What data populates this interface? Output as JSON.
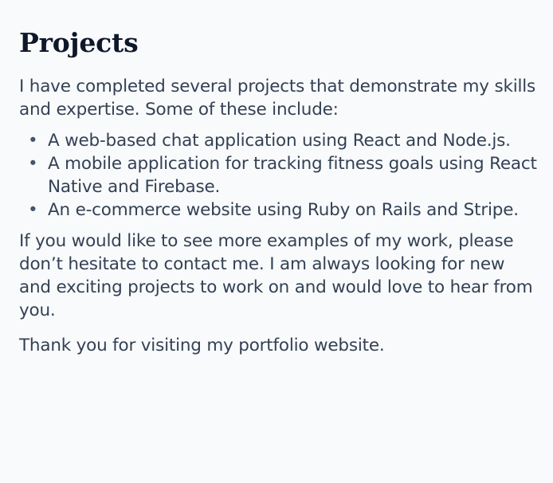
{
  "section": {
    "title": "Projects",
    "intro": "I have completed several projects that demonstrate my skills and expertise. Some of these include:",
    "projects": [
      "A web-based chat application using React and Node.js.",
      "A mobile application for tracking fitness goals using React Native and Firebase.",
      "An e-commerce website using Ruby on Rails and Stripe."
    ],
    "outro": "If you would like to see more examples of my work, please don’t hesitate to contact me. I am always looking for new and exciting projects to work on and would love to hear from you.",
    "closing": "Thank you for visiting my portfolio website.",
    "bullet_glyph": "•"
  }
}
